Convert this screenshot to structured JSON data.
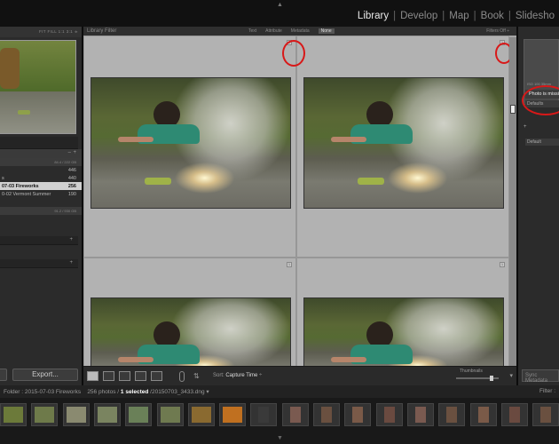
{
  "app": {
    "modules": [
      "Library",
      "Develop",
      "Map",
      "Book",
      "Slideshow"
    ],
    "module_display": [
      "Library",
      "Develop",
      "Map",
      "Book",
      "Slidesho"
    ],
    "active_module": "Library",
    "top_arrow": "▲",
    "bottom_arrow": "▼"
  },
  "navigator": {
    "zoom_options": "FIT  FILL  1:1  3:1  ≑"
  },
  "folders": {
    "volume1": "84.4 / 222 GB",
    "items": [
      {
        "label": "",
        "count": "446"
      },
      {
        "label": "s",
        "count": "440"
      },
      {
        "label": "07-03 Fireworks",
        "count": "256",
        "selected": true
      },
      {
        "label": "0-02 Vermont Summer",
        "count": "190"
      }
    ],
    "volume2": "91.2 / 930 GB",
    "plus1": "+",
    "minus": "–",
    "plus2": "+",
    "plus3": "+"
  },
  "left_buttons": {
    "import": "",
    "export": "Export..."
  },
  "library_filter": {
    "label": "Library Filter",
    "options": [
      "Text",
      "Attribute",
      "Metadata",
      "None"
    ],
    "active": "None",
    "filters_off": "Filters Off ÷"
  },
  "grid": {
    "cells": [
      {
        "badge": "1"
      },
      {
        "badge": "1"
      },
      {
        "badge": "1"
      },
      {
        "badge": "1"
      }
    ]
  },
  "toolbar": {
    "sort_label": "Sort:",
    "sort_value": "Capture Time",
    "thumbnails_label": "Thumbnails",
    "dropdown": "▾"
  },
  "right_panel": {
    "histogram_info": "ISO 100   35mm",
    "photo_warning": "Photo is missing",
    "defaults1": "Defaults",
    "plus": "+",
    "defaults2": "Default",
    "sync": "Sync Metadata"
  },
  "filmstrip": {
    "folder_path": "Folder : 2015-07-03 Fireworks",
    "count": "256 photos /",
    "selected": "1 selected",
    "filename": "/20150703_3433.dng ▾",
    "filter_label": "Filter :"
  },
  "colors": {
    "accent_circle": "#d81818",
    "grid_bg": "#a5a5a5",
    "panel_bg": "#2b2b2b"
  }
}
